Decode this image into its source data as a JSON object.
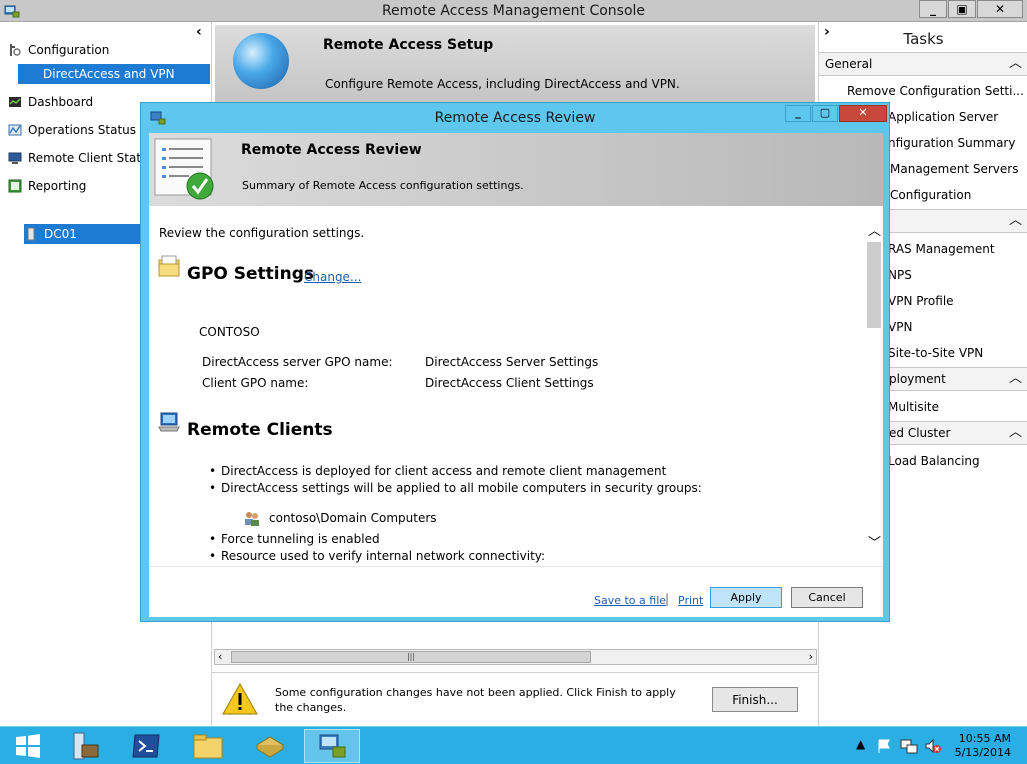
{
  "window": {
    "title": "Remote Access Management Console"
  },
  "nav": {
    "items": [
      {
        "label": "Configuration",
        "icon": "configuration-icon"
      },
      {
        "label": "DirectAccess and VPN",
        "selected": true
      },
      {
        "label": "Dashboard",
        "icon": "dashboard-icon"
      },
      {
        "label": "Operations Status",
        "icon": "operations-status-icon"
      },
      {
        "label": "Remote Client Status",
        "icon": "remote-client-icon"
      },
      {
        "label": "Reporting",
        "icon": "reporting-icon"
      }
    ],
    "server": "DC01"
  },
  "setup": {
    "title": "Remote Access Setup",
    "desc": "Configure Remote Access, including DirectAccess and VPN."
  },
  "warning": {
    "text": "Some configuration changes have not been applied. Click Finish to apply the changes.",
    "finish_label": "Finish..."
  },
  "tasks": {
    "header": "Tasks",
    "group_general": "General",
    "general_items": [
      "Remove Configuration Setti...",
      "Application Server",
      "nfiguration Summary",
      "Management Servers",
      "Configuration"
    ],
    "group2_items": [
      "RAS Management",
      "NPS",
      "VPN Profile",
      "VPN",
      "Site-to-Site VPN"
    ],
    "group_deployment": "ployment",
    "deployment_items": [
      "Multisite"
    ],
    "group_cluster": "ed Cluster",
    "cluster_items": [
      "Load Balancing"
    ]
  },
  "dialog": {
    "title": "Remote Access Review",
    "head_title": "Remote Access Review",
    "head_desc": "Summary of Remote Access configuration settings.",
    "intro": "Review the configuration settings.",
    "gpo": {
      "title": "GPO Settings",
      "change": "Change...",
      "domain": "CONTOSO",
      "server_key": "DirectAccess server GPO name:",
      "server_val": "DirectAccess Server Settings",
      "client_key": "Client GPO name:",
      "client_val": "DirectAccess Client Settings"
    },
    "clients": {
      "title": "Remote Clients",
      "bullets": [
        "DirectAccess is deployed for client access and remote client management",
        "DirectAccess settings will be applied to all mobile computers in security groups:"
      ],
      "group": "contoso\\Domain Computers",
      "bullets2": [
        "Force tunneling is enabled",
        "Resource used to verify internal network connectivity:"
      ]
    },
    "footer": {
      "save": "Save to a file",
      "sep": "|",
      "print": "Print",
      "apply": "Apply",
      "cancel": "Cancel"
    }
  },
  "clock": {
    "time": "10:55 AM",
    "date": "5/13/2014"
  }
}
